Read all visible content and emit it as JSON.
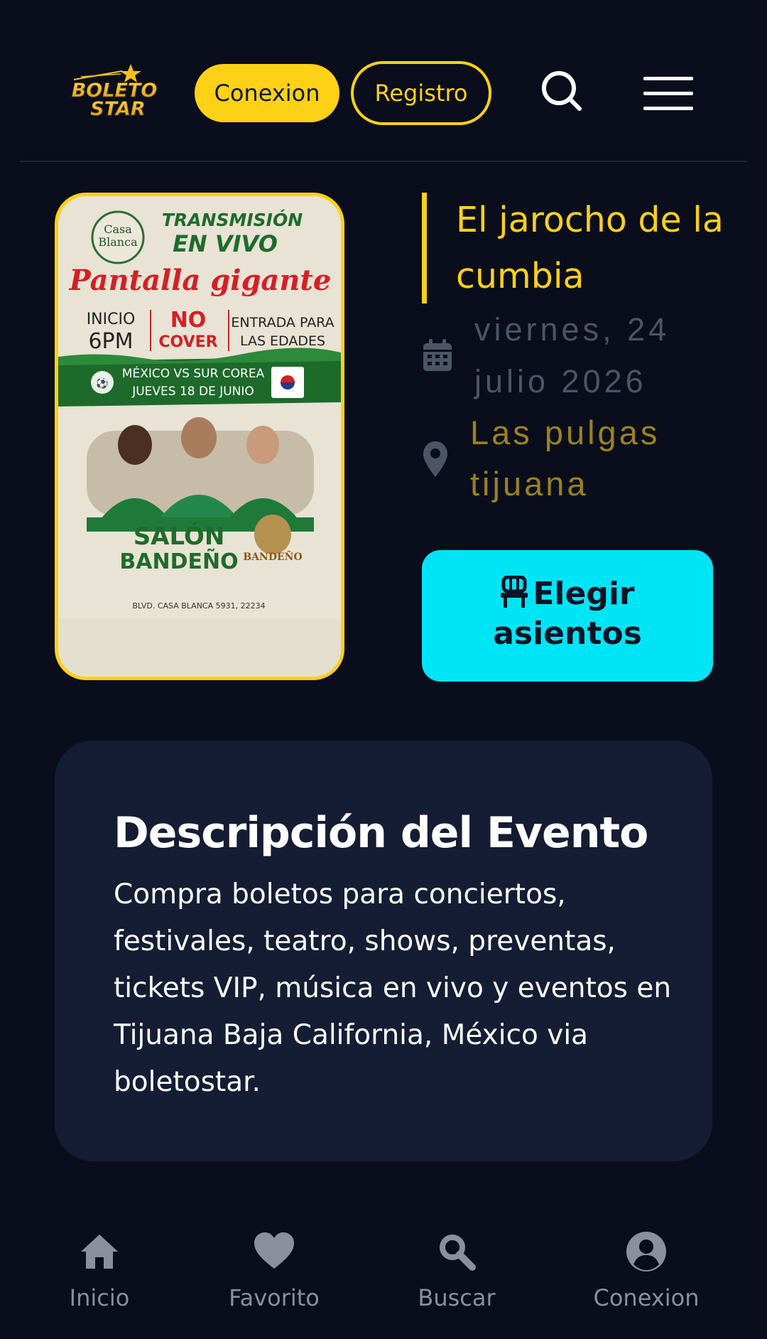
{
  "header": {
    "logo_text_line1": "BOLETO",
    "logo_text_line2": "STAR",
    "login_label": "Conexion",
    "register_label": "Registro"
  },
  "event": {
    "title": "El jarocho de la cumbia",
    "date": "viernes, 24 julio 2026",
    "venue": "Las pulgas tijuana",
    "seats_button_label": "Elegir asientos"
  },
  "poster": {
    "brand_line1": "Casa",
    "brand_line2": "Blanca",
    "headline_line1": "TRANSMISIÓN",
    "headline_line2": "EN VIVO",
    "script_text": "Pantalla gigante",
    "col1_line1": "INICIO",
    "col1_line2": "6PM",
    "col2_line1": "NO",
    "col2_line2": "COVER",
    "col3_line1": "ENTRADA PARA",
    "col3_line2": "LAS EDADES",
    "match_line1": "MÉXICO VS SUR COREA",
    "match_line2": "JUEVES 18 DE JUNIO",
    "venue_line1": "SALÓN",
    "venue_line2": "BANDEÑO",
    "badge_text": "BANDEÑO",
    "address": "BLVD. CASA BLANCA 5931, 22234"
  },
  "description": {
    "title": "Descripción del Evento",
    "text": "Compra boletos para conciertos, festivales, teatro, shows, preventas, tickets VIP, música en vivo y eventos en Tijuana Baja California, México via boletostar."
  },
  "bottom_nav": {
    "items": [
      {
        "label": "Inicio",
        "icon": "home-icon"
      },
      {
        "label": "Favorito",
        "icon": "heart-icon"
      },
      {
        "label": "Buscar",
        "icon": "search-icon"
      },
      {
        "label": "Conexion",
        "icon": "user-circle-icon"
      }
    ]
  },
  "colors": {
    "background": "#0a0e1c",
    "accent_yellow": "#fcd116",
    "accent_cyan": "#00e5f6",
    "card": "#141d33",
    "muted": "#8a8f9c"
  }
}
